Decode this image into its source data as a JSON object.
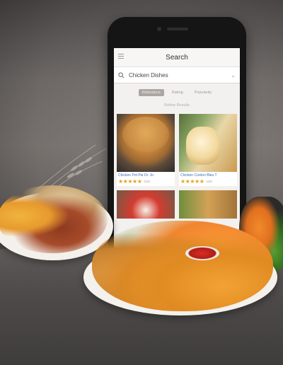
{
  "screen": {
    "title": "Search"
  },
  "search": {
    "query": "Chicken Dishes"
  },
  "filters": [
    {
      "label": "Relevance",
      "active": true
    },
    {
      "label": "Rating",
      "active": false
    },
    {
      "label": "Popularity",
      "active": false
    }
  ],
  "subfilter": "Refine Results",
  "results": [
    {
      "title": "Chicken Pot Pie Dr. Jo",
      "stars": "★★★★★",
      "count": "1234"
    },
    {
      "title": "Chicken Cordon Bleu T",
      "stars": "★★★★★",
      "count": "1234"
    }
  ],
  "colors": {
    "accent_link": "#3a6bb8",
    "star": "#e2a419",
    "active_filter_bg": "#aba6a2"
  }
}
